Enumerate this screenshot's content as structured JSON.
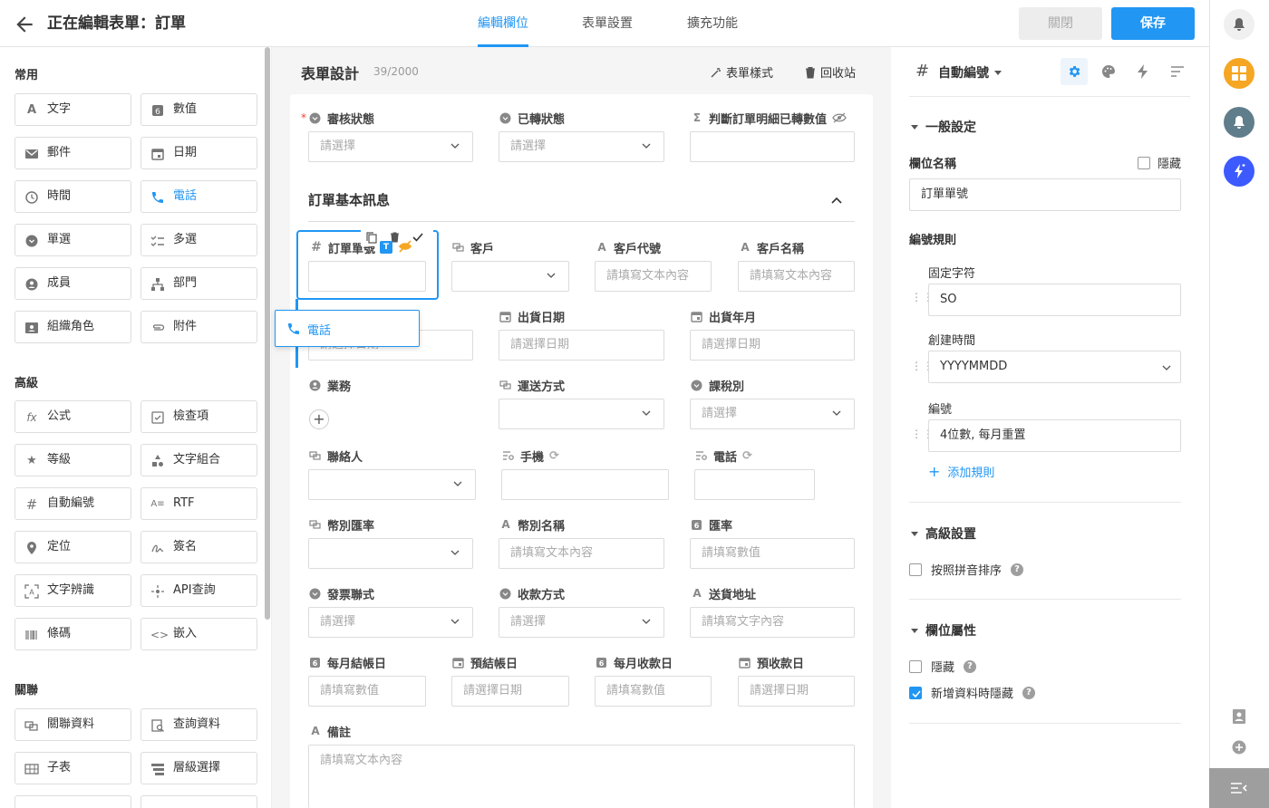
{
  "header": {
    "title": "正在編輯表單：訂單",
    "tabs": [
      "編輯欄位",
      "表單設置",
      "擴充功能"
    ],
    "close_label": "關閉",
    "save_label": "保存"
  },
  "palette": {
    "sections": [
      "常用",
      "高級",
      "關聯"
    ],
    "common": [
      {
        "label": "文字",
        "icon": "text-a-icon"
      },
      {
        "label": "數值",
        "icon": "number-icon"
      },
      {
        "label": "郵件",
        "icon": "mail-icon"
      },
      {
        "label": "日期",
        "icon": "calendar-icon"
      },
      {
        "label": "時間",
        "icon": "clock-icon"
      },
      {
        "label": "電話",
        "icon": "phone-icon"
      },
      {
        "label": "單選",
        "icon": "radio-icon"
      },
      {
        "label": "多選",
        "icon": "checklist-icon"
      },
      {
        "label": "成員",
        "icon": "member-icon"
      },
      {
        "label": "部門",
        "icon": "department-icon"
      },
      {
        "label": "組織角色",
        "icon": "role-icon"
      },
      {
        "label": "附件",
        "icon": "attachment-icon"
      }
    ],
    "advanced": [
      {
        "label": "公式",
        "icon": "formula-icon"
      },
      {
        "label": "檢查項",
        "icon": "checkbox-icon"
      },
      {
        "label": "等級",
        "icon": "star-icon"
      },
      {
        "label": "文字組合",
        "icon": "shapes-icon"
      },
      {
        "label": "自動編號",
        "icon": "hash-icon"
      },
      {
        "label": "RTF",
        "icon": "rtf-icon"
      },
      {
        "label": "定位",
        "icon": "location-icon"
      },
      {
        "label": "簽名",
        "icon": "signature-icon"
      },
      {
        "label": "文字辨識",
        "icon": "ocr-icon"
      },
      {
        "label": "API查詢",
        "icon": "api-icon"
      },
      {
        "label": "條碼",
        "icon": "barcode-icon"
      },
      {
        "label": "嵌入",
        "icon": "embed-icon"
      }
    ],
    "relation": [
      {
        "label": "關聯資料",
        "icon": "link-data-icon"
      },
      {
        "label": "查詢資料",
        "icon": "query-data-icon"
      },
      {
        "label": "子表",
        "icon": "table-icon"
      },
      {
        "label": "層級選擇",
        "icon": "cascade-icon"
      }
    ]
  },
  "form": {
    "title": "表單設計",
    "count": "39/2000",
    "style_label": "表單樣式",
    "recycle_label": "回收站",
    "section_title": "訂單基本訊息",
    "drag_ghost_label": "電話",
    "fields": {
      "review_status": {
        "label": "審核狀態",
        "placeholder": "請選擇"
      },
      "converted_status": {
        "label": "已轉狀態",
        "placeholder": "請選擇"
      },
      "judge_detail": {
        "label": "判斷訂單明細已轉數值",
        "placeholder": ""
      },
      "order_no": {
        "label": "訂單單號",
        "placeholder": ""
      },
      "customer": {
        "label": "客戶",
        "placeholder": ""
      },
      "customer_code": {
        "label": "客戶代號",
        "placeholder": "請填寫文本內容"
      },
      "customer_name": {
        "label": "客戶名稱",
        "placeholder": "請填寫文本內容"
      },
      "order_date": {
        "label": "",
        "placeholder": "請選擇日期"
      },
      "ship_date": {
        "label": "出貨日期",
        "placeholder": "請選擇日期"
      },
      "ship_month": {
        "label": "出貨年月",
        "placeholder": "請選擇日期"
      },
      "sales": {
        "label": "業務",
        "placeholder": ""
      },
      "shipping": {
        "label": "運送方式",
        "placeholder": ""
      },
      "tax_type": {
        "label": "課稅別",
        "placeholder": "請選擇"
      },
      "contact": {
        "label": "聯絡人",
        "placeholder": ""
      },
      "mobile": {
        "label": "手機",
        "placeholder": ""
      },
      "phone": {
        "label": "電話",
        "placeholder": ""
      },
      "currency_rate": {
        "label": "幣別匯率",
        "placeholder": ""
      },
      "currency_name": {
        "label": "幣別名稱",
        "placeholder": "請填寫文本內容"
      },
      "rate": {
        "label": "匯率",
        "placeholder": "請填寫數值"
      },
      "invoice": {
        "label": "發票聯式",
        "placeholder": "請選擇"
      },
      "payment": {
        "label": "收款方式",
        "placeholder": "請選擇"
      },
      "address": {
        "label": "送貨地址",
        "placeholder": "請填寫文字內容"
      },
      "monthly_close": {
        "label": "每月結帳日",
        "placeholder": "請填寫數值"
      },
      "pre_close": {
        "label": "預結帳日",
        "placeholder": "請選擇日期"
      },
      "monthly_collect": {
        "label": "每月收款日",
        "placeholder": "請填寫數值"
      },
      "pre_collect": {
        "label": "預收款日",
        "placeholder": "請選擇日期"
      },
      "remark": {
        "label": "備註",
        "placeholder": "請填寫文本內容"
      }
    }
  },
  "settings": {
    "field_type": "自動編號",
    "general_title": "一般設定",
    "field_name_label": "欄位名稱",
    "hide_label": "隱藏",
    "field_name_value": "訂單單號",
    "numbering_rules_label": "編號規則",
    "rules": [
      {
        "label": "固定字符",
        "value": "SO"
      },
      {
        "label": "創建時間",
        "value": "YYYYMMDD"
      },
      {
        "label": "編號",
        "value": "4位數, 每月重置"
      }
    ],
    "add_rule_label": "添加規則",
    "advanced_title": "高級設置",
    "pinyin_sort_label": "按照拼音排序",
    "attributes_title": "欄位屬性",
    "attr_hide_label": "隱藏",
    "hide_on_new_label": "新增資料時隱藏",
    "hide_on_new_checked": true,
    "help_glyph": "?"
  },
  "colors": {
    "accent": "#2196f3",
    "required": "#f44336",
    "apps_orange": "#f5a623",
    "bell_gray": "#607d8b",
    "ai_blue": "#3d5afe"
  }
}
